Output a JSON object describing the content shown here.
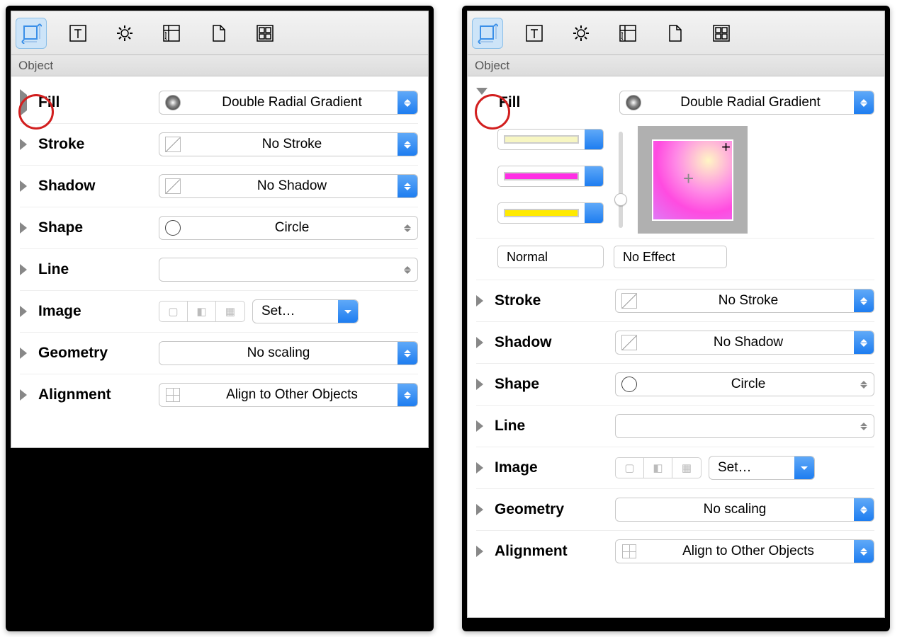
{
  "panels": {
    "subheader": "Object",
    "rows": {
      "fill": {
        "label": "Fill",
        "value": "Double Radial Gradient"
      },
      "stroke": {
        "label": "Stroke",
        "value": "No Stroke"
      },
      "shadow": {
        "label": "Shadow",
        "value": "No Shadow"
      },
      "shape": {
        "label": "Shape",
        "value": "Circle"
      },
      "line": {
        "label": "Line",
        "value": ""
      },
      "image": {
        "label": "Image",
        "button": "Set…"
      },
      "geometry": {
        "label": "Geometry",
        "value": "No scaling"
      },
      "alignment": {
        "label": "Alignment",
        "value": "Align to Other Objects"
      }
    },
    "fillExpanded": {
      "colors": [
        "#f7f6c2",
        "#ff2ee4",
        "#ffea00"
      ],
      "blendMode": "Normal",
      "effect": "No Effect"
    }
  }
}
